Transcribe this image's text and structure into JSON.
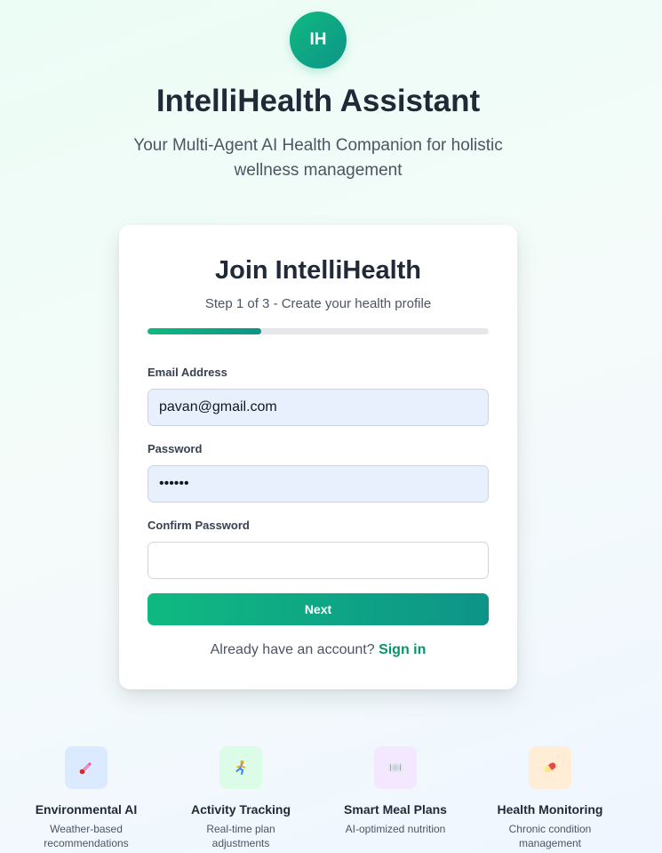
{
  "header": {
    "logo_text": "IH",
    "title": "IntelliHealth Assistant",
    "subtitle": "Your Multi-Agent AI Health Companion for holistic wellness management"
  },
  "signup": {
    "title": "Join IntelliHealth",
    "step_text": "Step 1 of 3 - Create your health profile",
    "progress_fraction": 0.333,
    "email": {
      "label": "Email Address",
      "value": "pavan@gmail.com"
    },
    "password": {
      "label": "Password",
      "value": "pavan1"
    },
    "confirm_password": {
      "label": "Confirm Password",
      "value": ""
    },
    "next_label": "Next",
    "signin_prompt": "Already have an account?",
    "signin_link": "Sign in"
  },
  "features": [
    {
      "title": "Environmental AI",
      "description": "Weather-based recommendations",
      "icon": "thermometer-icon",
      "bg": "#dbeafe"
    },
    {
      "title": "Activity Tracking",
      "description": "Real-time plan adjustments",
      "icon": "running-icon",
      "bg": "#dcfce7"
    },
    {
      "title": "Smart Meal Plans",
      "description": "AI-optimized nutrition",
      "icon": "meal-icon",
      "bg": "#f3e8ff"
    },
    {
      "title": "Health Monitoring",
      "description": "Chronic condition management",
      "icon": "pill-icon",
      "bg": "#ffedd5"
    }
  ]
}
